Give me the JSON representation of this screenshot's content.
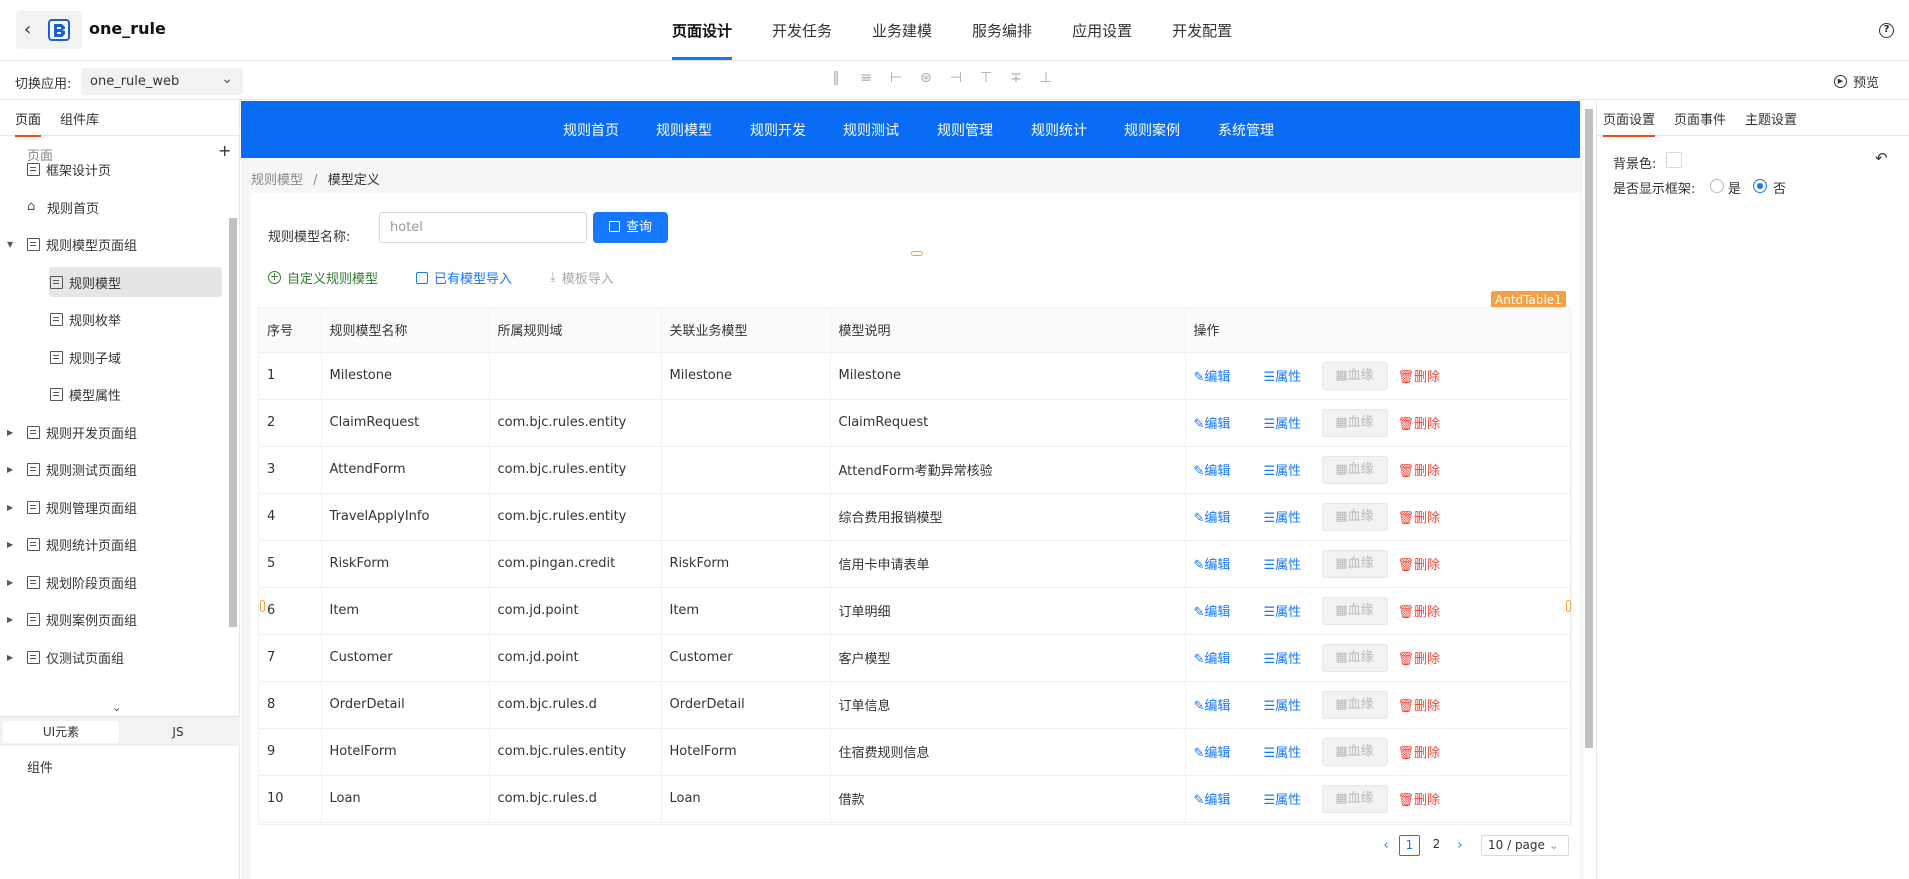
{
  "header": {
    "app_name": "one_rule",
    "tabs": [
      "页面设计",
      "开发任务",
      "业务建模",
      "服务编排",
      "应用设置",
      "开发配置"
    ],
    "active_tab": "页面设计",
    "help_icon": "question-circle-icon",
    "help_glyph": "?"
  },
  "toolbar2": {
    "switch_label": "切换应用:",
    "app_value": "one_rule_web",
    "preview_label": "预览"
  },
  "left": {
    "tabs": [
      "页面",
      "组件库"
    ],
    "tree_header": "页面",
    "nodes": [
      {
        "label": "框架设计页"
      },
      {
        "label": "规则首页"
      },
      {
        "label": "规则模型页面组"
      },
      {
        "label": "规则模型"
      },
      {
        "label": "规则枚举"
      },
      {
        "label": "规则子域"
      },
      {
        "label": "模型属性"
      },
      {
        "label": "规则开发页面组"
      },
      {
        "label": "规则测试页面组"
      },
      {
        "label": "规则管理页面组"
      },
      {
        "label": "规则统计页面组"
      },
      {
        "label": "规划阶段页面组"
      },
      {
        "label": "规则案例页面组"
      },
      {
        "label": "仅测试页面组"
      }
    ],
    "bottom_tabs": [
      "UI元素",
      "JS"
    ],
    "component_label": "组件"
  },
  "canvas": {
    "nav": [
      "规则首页",
      "规则模型",
      "规则开发",
      "规则测试",
      "规则管理",
      "规则统计",
      "规则案例",
      "系统管理"
    ],
    "breadcrumb": {
      "parent": "规则模型",
      "sep": "/",
      "current": "模型定义"
    },
    "query_label": "规则模型名称:",
    "query_placeholder": "hotel",
    "query_button": "查询",
    "actions": [
      "自定义规则模型",
      "已有模型导入",
      "模板导入"
    ],
    "table_tag": "AntdTable1",
    "columns": [
      "序号",
      "规则模型名称",
      "所属规则域",
      "关联业务模型",
      "模型说明",
      "操作"
    ],
    "rows": [
      [
        "1",
        "Milestone",
        "",
        "Milestone",
        "Milestone"
      ],
      [
        "2",
        "ClaimRequest",
        "com.bjc.rules.entity",
        "",
        "ClaimRequest"
      ],
      [
        "3",
        "AttendForm",
        "com.bjc.rules.entity",
        "",
        "AttendForm考勤异常核验"
      ],
      [
        "4",
        "TravelApplyInfo",
        "com.bjc.rules.entity",
        "",
        "综合费用报销模型"
      ],
      [
        "5",
        "RiskForm",
        "com.pingan.credit",
        "RiskForm",
        "信用卡申请表单"
      ],
      [
        "6",
        "Item",
        "com.jd.point",
        "Item",
        "订单明细"
      ],
      [
        "7",
        "Customer",
        "com.jd.point",
        "Customer",
        "客户模型"
      ],
      [
        "8",
        "OrderDetail",
        "com.bjc.rules.d",
        "OrderDetail",
        "订单信息"
      ],
      [
        "9",
        "HotelForm",
        "com.bjc.rules.entity",
        "HotelForm",
        "住宿费规则信息"
      ],
      [
        "10",
        "Loan",
        "com.bjc.rules.d",
        "Loan",
        "借款"
      ]
    ],
    "ops": {
      "edit": "编辑",
      "prop": "属性",
      "lineage": "血缘",
      "delete": "删除"
    },
    "pager": {
      "pages": [
        "1",
        "2"
      ],
      "current": "1",
      "size": "10 / page"
    }
  },
  "right": {
    "tabs": [
      "页面设置",
      "页面事件",
      "主题设置"
    ],
    "bg_label": "背景色:",
    "frame_label": "是否显示框架:",
    "yes": "是",
    "no": "否",
    "frame_selected": "否"
  },
  "colors": {
    "primary": "#1677ff",
    "nav_blue": "#0a6cf5",
    "danger": "#f44336",
    "tag": "#f5a045",
    "accent": "#e64a19"
  }
}
